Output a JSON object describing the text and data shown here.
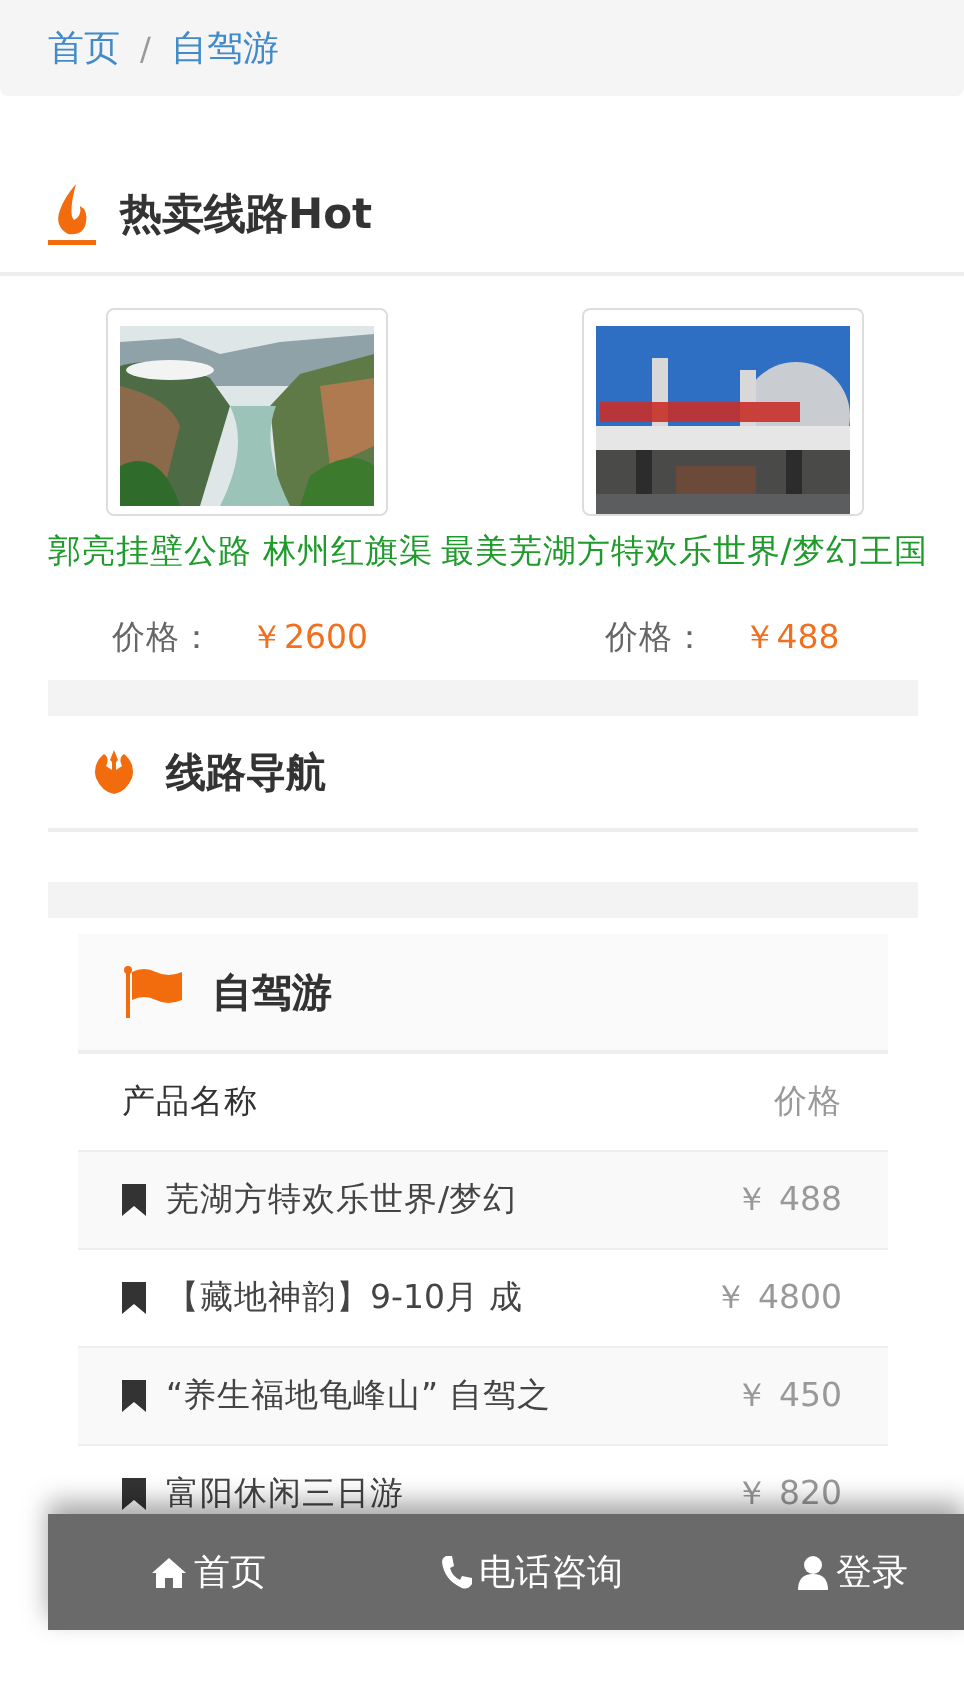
{
  "breadcrumb": {
    "items": [
      {
        "label": "首页"
      },
      {
        "label": "自驾游"
      }
    ],
    "separator": "/"
  },
  "hot": {
    "title": "热卖线路Hot",
    "products": [
      {
        "title": "郭亮挂壁公路 林州红旗渠",
        "price_label": "价格：",
        "price": "￥2600"
      },
      {
        "title": "最美芜湖方特欢乐世界/梦幻王国",
        "price_label": "价格：",
        "price": "￥488"
      }
    ]
  },
  "route_nav": {
    "title": "线路导航"
  },
  "category": {
    "title": "自驾游",
    "columns": [
      "产品名称",
      "价格"
    ],
    "rows": [
      {
        "name": "芜湖方特欢乐世界/梦幻",
        "price": "￥ 488"
      },
      {
        "name": "【藏地神韵】9-10月 成",
        "price": "￥ 4800"
      },
      {
        "name": "“养生福地龟峰山” 自驾之",
        "price": "￥ 450"
      },
      {
        "name": "富阳休闲三日游",
        "price": "￥ 820"
      }
    ]
  },
  "bottom_nav": [
    {
      "label": "首页"
    },
    {
      "label": "电话咨询"
    },
    {
      "label": "登录"
    }
  ]
}
